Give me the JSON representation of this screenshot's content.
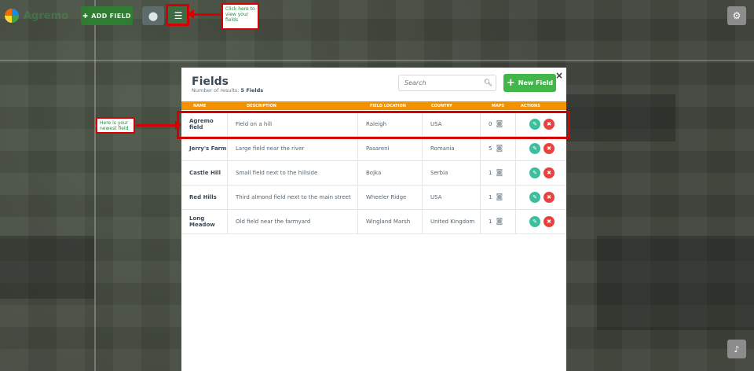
{
  "app": {
    "logo_text": "Agremo"
  },
  "toolbar": {
    "add_field_label": "ADD FIELD",
    "pin_icon": "map-pin-icon",
    "list_icon": "list-icon",
    "settings_icon": "gear-icon",
    "notifications_icon": "bell-icon"
  },
  "annotations": {
    "list_callout": "Click here to view your fields",
    "row_callout": "Here is your newest field"
  },
  "modal": {
    "title": "Fields",
    "subtitle_prefix": "Number of results: ",
    "result_count": "5 Fields",
    "close_symbol": "×",
    "search_placeholder": "Search",
    "new_field_label": "New Field"
  },
  "table": {
    "columns": [
      "NAME",
      "DESCRIPTION",
      "FIELD LOCATION",
      "COUNTRY",
      "MAPS",
      "ACTIONS"
    ],
    "rows": [
      {
        "name": "Agremo field",
        "description": "Field on a hill",
        "location": "Raleigh",
        "country": "USA",
        "maps": "0"
      },
      {
        "name": "Jerry's Farm",
        "description": "Large field near the river",
        "location": "Pasareni",
        "country": "Romania",
        "maps": "5"
      },
      {
        "name": "Castle Hill",
        "description": "Small field next to the hillside",
        "location": "Bojka",
        "country": "Serbia",
        "maps": "1"
      },
      {
        "name": "Red Hills",
        "description": "Third almond field next to the main street",
        "location": "Wheeler Ridge",
        "country": "USA",
        "maps": "1"
      },
      {
        "name": "Long Meadow",
        "description": "Old field near the farmyard",
        "location": "Wingland Marsh",
        "country": "United Kingdom",
        "maps": "1"
      }
    ]
  },
  "colors": {
    "header_orange": "#f39200",
    "new_field_green": "#43b649",
    "edit_teal": "#3bbf9f",
    "delete_red": "#e8413e",
    "annotation_red": "#d50000"
  }
}
